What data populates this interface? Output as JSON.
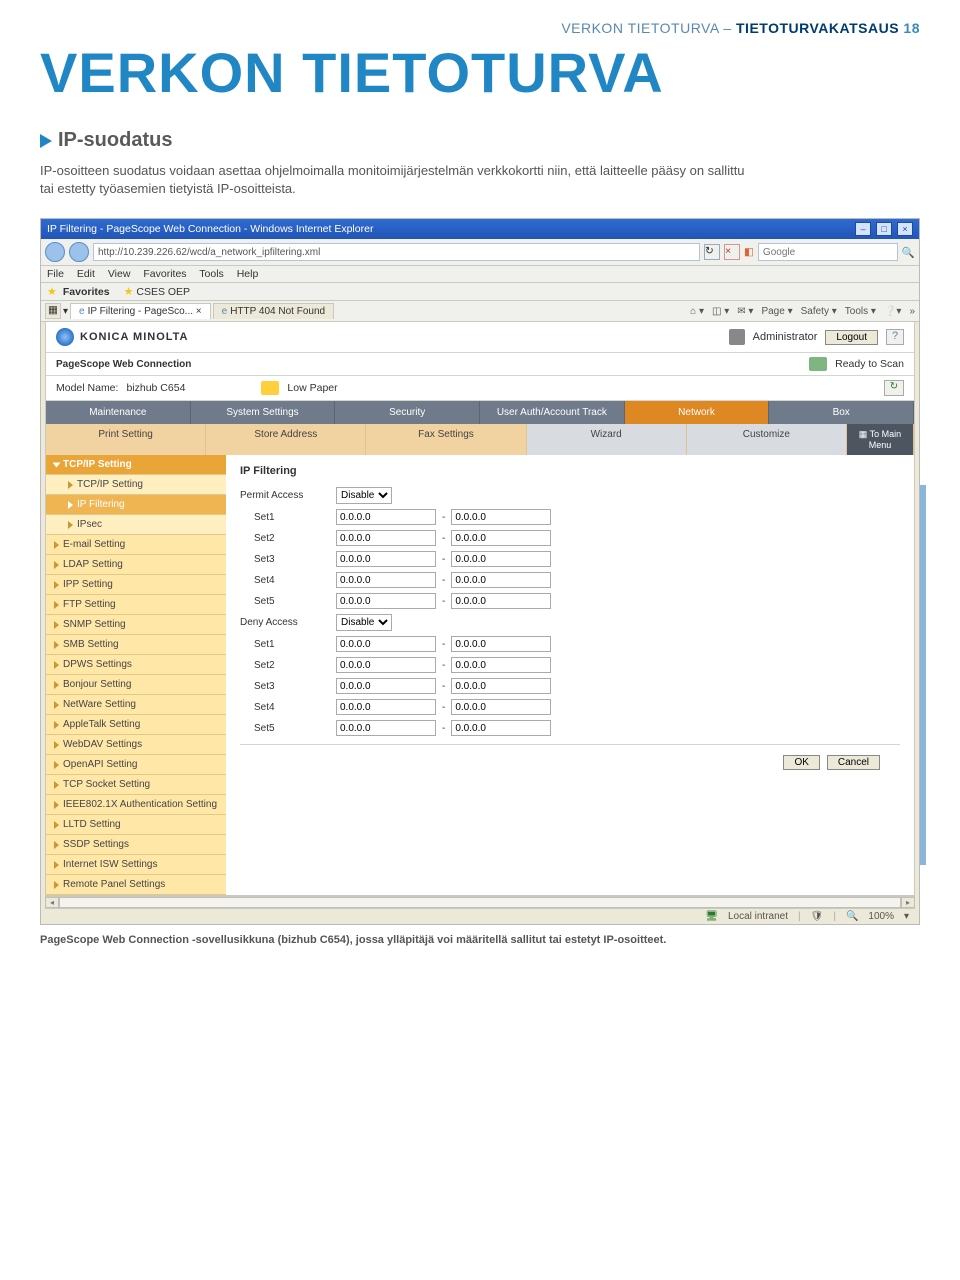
{
  "doc_header": {
    "light": "VERKON TIETOTURVA – ",
    "bold": "TIETOTURVAKATSAUS",
    "page_num": "18"
  },
  "doc_title": "VERKON TIETOTURVA",
  "doc_subtitle": "IP-suodatus",
  "doc_body": "IP-osoitteen suodatus voidaan asettaa ohjelmoimalla monitoimijärjestelmän verkkokortti niin, että laitteelle pääsy on sallittu tai estetty työasemien tietyistä IP-osoitteista.",
  "caption": "PageScope Web Connection -sovellusikkuna (bizhub C654), jossa ylläpitäjä voi määritellä sallitut tai estetyt IP-osoitteet.",
  "browser": {
    "title": "IP Filtering - PageScope Web Connection - Windows Internet Explorer",
    "url": "http://10.239.226.62/wcd/a_network_ipfiltering.xml",
    "search_placeholder": "Google",
    "menu": [
      "File",
      "Edit",
      "View",
      "Favorites",
      "Tools",
      "Help"
    ],
    "fav_label": "Favorites",
    "fav_item": "CSES OEP",
    "tab1": "IP Filtering - PageSco... ×",
    "tab2": "HTTP 404 Not Found",
    "toolbtn": [
      "Page",
      "Safety",
      "Tools"
    ]
  },
  "km": {
    "brand": "KONICA MINOLTA",
    "admin_icon_label": "Administrator",
    "logout": "Logout",
    "pagescope": "PageScope Web Connection",
    "ready": "Ready to Scan",
    "model_label": "Model Name:",
    "model_value": "bizhub C654",
    "low_paper": "Low Paper"
  },
  "navtabs": [
    "Maintenance",
    "System Settings",
    "Security",
    "User Auth/Account Track",
    "Network",
    "Box"
  ],
  "subnavtabs": [
    "Print Setting",
    "Store Address",
    "Fax Settings",
    "Wizard",
    "Customize"
  ],
  "to_main": "To Main Menu",
  "sidebar": {
    "head": "TCP/IP Setting",
    "sub": [
      "TCP/IP Setting",
      "IP Filtering",
      "IPsec"
    ],
    "rest": [
      "E-mail Setting",
      "LDAP Setting",
      "IPP Setting",
      "FTP Setting",
      "SNMP Setting",
      "SMB Setting",
      "DPWS Settings",
      "Bonjour Setting",
      "NetWare Setting",
      "AppleTalk Setting",
      "WebDAV Settings",
      "OpenAPI Setting",
      "TCP Socket Setting",
      "IEEE802.1X Authentication Setting",
      "LLTD Setting",
      "SSDP Settings",
      "Internet ISW Settings",
      "Remote Panel Settings"
    ]
  },
  "filter": {
    "title": "IP Filtering",
    "permit": "Permit Access",
    "deny": "Deny Access",
    "disable": "Disable",
    "rows": [
      "Set1",
      "Set2",
      "Set3",
      "Set4",
      "Set5"
    ],
    "ip": "0.0.0.0",
    "ok": "OK",
    "cancel": "Cancel"
  },
  "status": {
    "zone": "Local intranet",
    "zoom": "100%"
  }
}
